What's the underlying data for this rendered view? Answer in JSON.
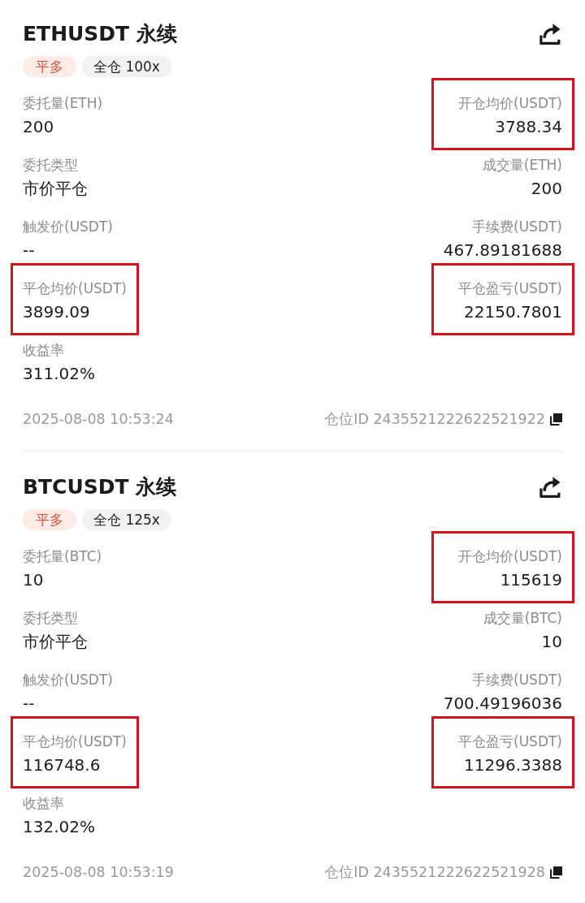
{
  "positions": [
    {
      "title": "ETHUSDT 永续",
      "tags": [
        {
          "kind": "side",
          "text": "平多"
        },
        {
          "kind": "margin",
          "text": "全仓 100x"
        }
      ],
      "rows": [
        {
          "cells": [
            {
              "label": "委托量(ETH)",
              "value": "200",
              "highlighted": false
            },
            {
              "label": "开仓均价(USDT)",
              "value": "3788.34",
              "highlighted": true
            }
          ]
        },
        {
          "cells": [
            {
              "label": "委托类型",
              "value": "市价平仓",
              "highlighted": false
            },
            {
              "label": "成交量(ETH)",
              "value": "200",
              "highlighted": false
            }
          ]
        },
        {
          "cells": [
            {
              "label": "触发价(USDT)",
              "value": "--",
              "highlighted": false
            },
            {
              "label": "手续费(USDT)",
              "value": "467.89181688",
              "highlighted": false
            }
          ]
        },
        {
          "cells": [
            {
              "label": "平仓均价(USDT)",
              "value": "3899.09",
              "highlighted": true
            },
            {
              "label": "平仓盈亏(USDT)",
              "value": "22150.7801",
              "highlighted": true
            }
          ]
        },
        {
          "cells": [
            {
              "label": "收益率",
              "value": "311.02%",
              "highlighted": false
            }
          ]
        }
      ],
      "time": "2025-08-08 10:53:24",
      "position_id": "仓位ID 2435521222622521922"
    },
    {
      "title": "BTCUSDT 永续",
      "tags": [
        {
          "kind": "side",
          "text": "平多"
        },
        {
          "kind": "margin",
          "text": "全仓 125x"
        }
      ],
      "rows": [
        {
          "cells": [
            {
              "label": "委托量(BTC)",
              "value": "10",
              "highlighted": false
            },
            {
              "label": "开仓均价(USDT)",
              "value": "115619",
              "highlighted": true
            }
          ]
        },
        {
          "cells": [
            {
              "label": "委托类型",
              "value": "市价平仓",
              "highlighted": false
            },
            {
              "label": "成交量(BTC)",
              "value": "10",
              "highlighted": false
            }
          ]
        },
        {
          "cells": [
            {
              "label": "触发价(USDT)",
              "value": "--",
              "highlighted": false
            },
            {
              "label": "手续费(USDT)",
              "value": "700.49196036",
              "highlighted": false
            }
          ]
        },
        {
          "cells": [
            {
              "label": "平仓均价(USDT)",
              "value": "116748.6",
              "highlighted": true
            },
            {
              "label": "平仓盈亏(USDT)",
              "value": "11296.3388",
              "highlighted": true
            }
          ]
        },
        {
          "cells": [
            {
              "label": "收益率",
              "value": "132.02%",
              "highlighted": false
            }
          ]
        }
      ],
      "time": "2025-08-08 10:53:19",
      "position_id": "仓位ID 2435521222622521928"
    }
  ]
}
